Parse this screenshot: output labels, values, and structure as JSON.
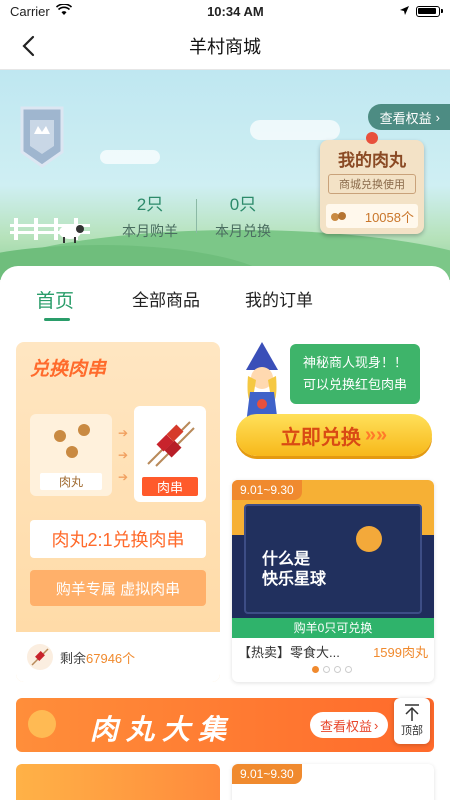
{
  "status_bar": {
    "carrier": "Carrier",
    "time": "10:34 AM"
  },
  "nav": {
    "title": "羊村商城"
  },
  "hero": {
    "stats": [
      {
        "value": "2只",
        "label": "本月购羊"
      },
      {
        "value": "0只",
        "label": "本月兑换"
      }
    ],
    "view_rights": "查看权益",
    "meatball_card": {
      "title": "我的肉丸",
      "subtitle": "商城兑换使用",
      "count": "10058个"
    }
  },
  "tabs": [
    {
      "label": "首页",
      "active": true
    },
    {
      "label": "全部商品",
      "active": false
    },
    {
      "label": "我的订单",
      "active": false
    }
  ],
  "exchange_card": {
    "title": "兑换肉串",
    "from_label": "肉丸",
    "to_label": "肉串",
    "ratio": "肉丸2:1兑换肉串",
    "exclusive": "购羊专属 虚拟肉串",
    "remaining_prefix": "剩余",
    "remaining_count": "67946个"
  },
  "merchant": {
    "line1": "神秘商人现身！！",
    "line2": "可以兑换红包肉串",
    "cta": "立即兑换"
  },
  "product": {
    "date": "9.01~9.30",
    "box_text_line1": "什么是",
    "box_text_line2": "快乐星球",
    "condition": "购羊0只可兑换",
    "name": "【热卖】零食大...",
    "price": "1599肉丸"
  },
  "carousel": {
    "total": 4,
    "active": 0
  },
  "market": {
    "title": "肉丸大集",
    "rights": "查看权益"
  },
  "to_top": {
    "label": "顶部"
  },
  "bottom_cards": [
    {
      "date": ""
    },
    {
      "date": "9.01~9.30"
    }
  ],
  "colors": {
    "accent_green": "#2a9d6a",
    "accent_orange": "#f08a2e"
  }
}
